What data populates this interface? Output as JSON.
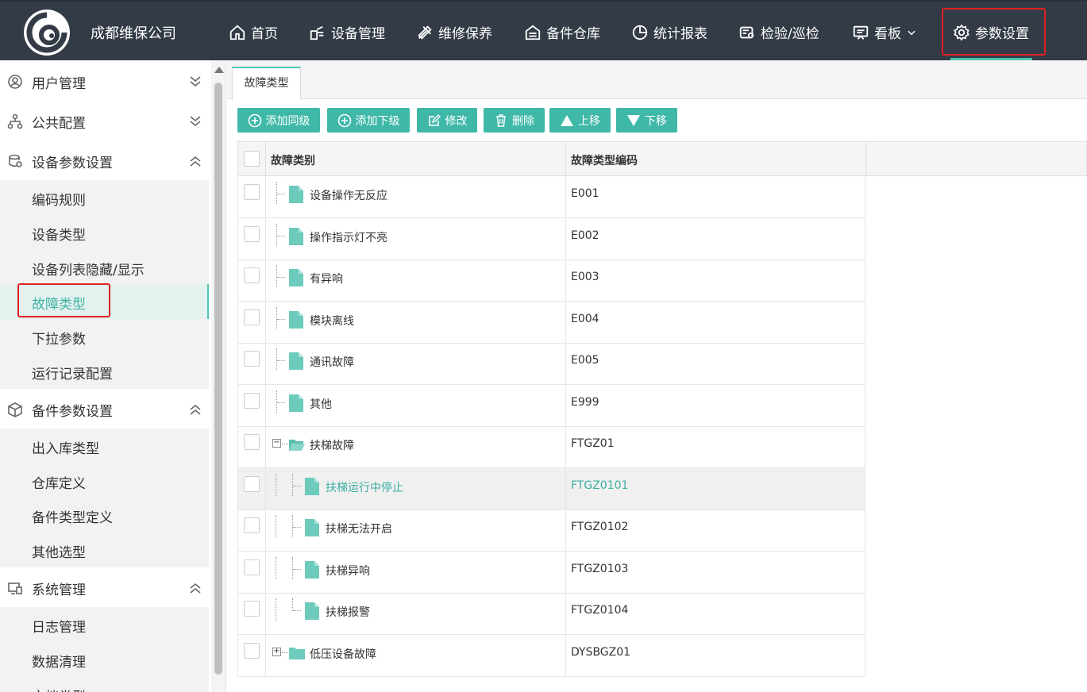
{
  "app": {
    "brand": "成都维保公司"
  },
  "nav": [
    {
      "label": "首页",
      "icon": "home-icon"
    },
    {
      "label": "设备管理",
      "icon": "device-icon"
    },
    {
      "label": "维修保养",
      "icon": "tools-icon"
    },
    {
      "label": "备件仓库",
      "icon": "warehouse-icon"
    },
    {
      "label": "统计报表",
      "icon": "pie-chart-icon"
    },
    {
      "label": "检验/巡检",
      "icon": "inspect-icon"
    },
    {
      "label": "看板",
      "icon": "board-icon"
    },
    {
      "label": "参数设置",
      "icon": "gear-icon"
    }
  ],
  "sidebar": {
    "groups": [
      {
        "label": "用户管理",
        "icon": "user-icon",
        "expanded": false
      },
      {
        "label": "公共配置",
        "icon": "org-icon",
        "expanded": false
      },
      {
        "label": "设备参数设置",
        "icon": "device-settings-icon",
        "expanded": true,
        "items": [
          "编码规则",
          "设备类型",
          "设备列表隐藏/显示",
          "故障类型",
          "下拉参数",
          "运行记录配置"
        ]
      },
      {
        "label": "备件参数设置",
        "icon": "box-icon",
        "expanded": true,
        "items": [
          "出入库类型",
          "仓库定义",
          "备件类型定义",
          "其他选型"
        ]
      },
      {
        "label": "系统管理",
        "icon": "monitor-icon",
        "expanded": true,
        "items": [
          "日志管理",
          "数据清理",
          "文档类型"
        ]
      }
    ],
    "active_item": "故障类型"
  },
  "tab": {
    "label": "故障类型"
  },
  "toolbar": {
    "add_sibling": "添加同级",
    "add_child": "添加下级",
    "edit": "修改",
    "delete": "删除",
    "move_up": "上移",
    "move_down": "下移"
  },
  "grid": {
    "columns": [
      "故障类别",
      "故障类型编码"
    ],
    "rows": [
      {
        "name": "设备操作无反应",
        "code": "E001"
      },
      {
        "name": "操作指示灯不亮",
        "code": "E002"
      },
      {
        "name": "有异响",
        "code": "E003"
      },
      {
        "name": "模块离线",
        "code": "E004"
      },
      {
        "name": "通讯故障",
        "code": "E005"
      },
      {
        "name": "其他",
        "code": "E999"
      },
      {
        "name": "扶梯故障",
        "code": "FTGZ01"
      },
      {
        "name": "扶梯运行中停止",
        "code": "FTGZ0101"
      },
      {
        "name": "扶梯无法开启",
        "code": "FTGZ0102"
      },
      {
        "name": "扶梯异响",
        "code": "FTGZ0103"
      },
      {
        "name": "扶梯报警",
        "code": "FTGZ0104"
      },
      {
        "name": "低压设备故障",
        "code": "DYSBGZ01"
      }
    ]
  },
  "colors": {
    "accent": "#3fb8a8",
    "topbar": "#333b46",
    "highlight": "#e02020"
  }
}
